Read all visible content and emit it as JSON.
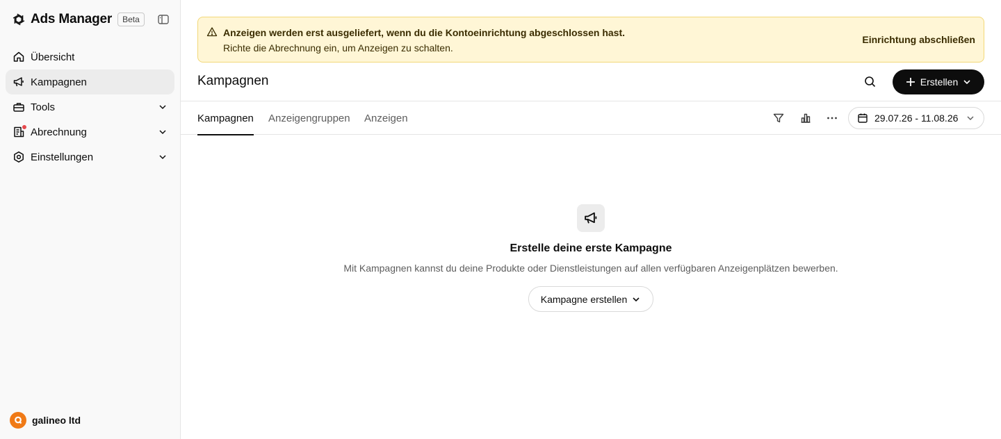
{
  "app": {
    "name": "Ads Manager",
    "badge": "Beta"
  },
  "sidebar": {
    "items": [
      {
        "label": "Übersicht",
        "icon": "home-icon"
      },
      {
        "label": "Kampagnen",
        "icon": "megaphone-icon",
        "active": true
      },
      {
        "label": "Tools",
        "icon": "toolbox-icon",
        "expandable": true
      },
      {
        "label": "Abrechnung",
        "icon": "billing-icon",
        "expandable": true,
        "notification": true
      },
      {
        "label": "Einstellungen",
        "icon": "gear-icon",
        "expandable": true
      }
    ],
    "account": {
      "name": "galineo ltd",
      "avatar_color": "#f07a16"
    }
  },
  "banner": {
    "icon": "warning-icon",
    "title": "Anzeigen werden erst ausgeliefert, wenn du die Kontoeinrichtung abgeschlossen hast.",
    "subtitle": "Richte die Abrechnung ein, um Anzeigen zu schalten.",
    "action": "Einrichtung abschließen",
    "background": "#fff6d6"
  },
  "header": {
    "title": "Kampagnen",
    "create_label": "Erstellen"
  },
  "tabs": [
    {
      "label": "Kampagnen",
      "active": true
    },
    {
      "label": "Anzeigengruppen"
    },
    {
      "label": "Anzeigen"
    }
  ],
  "toolbar": {
    "icons": [
      "filter-icon",
      "chart-icon",
      "more-icon"
    ],
    "date_range": "29.07.26 - 11.08.26"
  },
  "empty_state": {
    "icon": "megaphone-icon",
    "title": "Erstelle deine erste Kampagne",
    "description": "Mit Kampagnen kannst du deine Produkte oder Dienstleistungen auf allen verfügbaren Anzeigenplätzen bewerben.",
    "button": "Kampagne erstellen"
  },
  "colors": {
    "accent": "#0d0d0d",
    "notification": "#e5484d",
    "sidebar_bg": "#f9f9f9"
  }
}
